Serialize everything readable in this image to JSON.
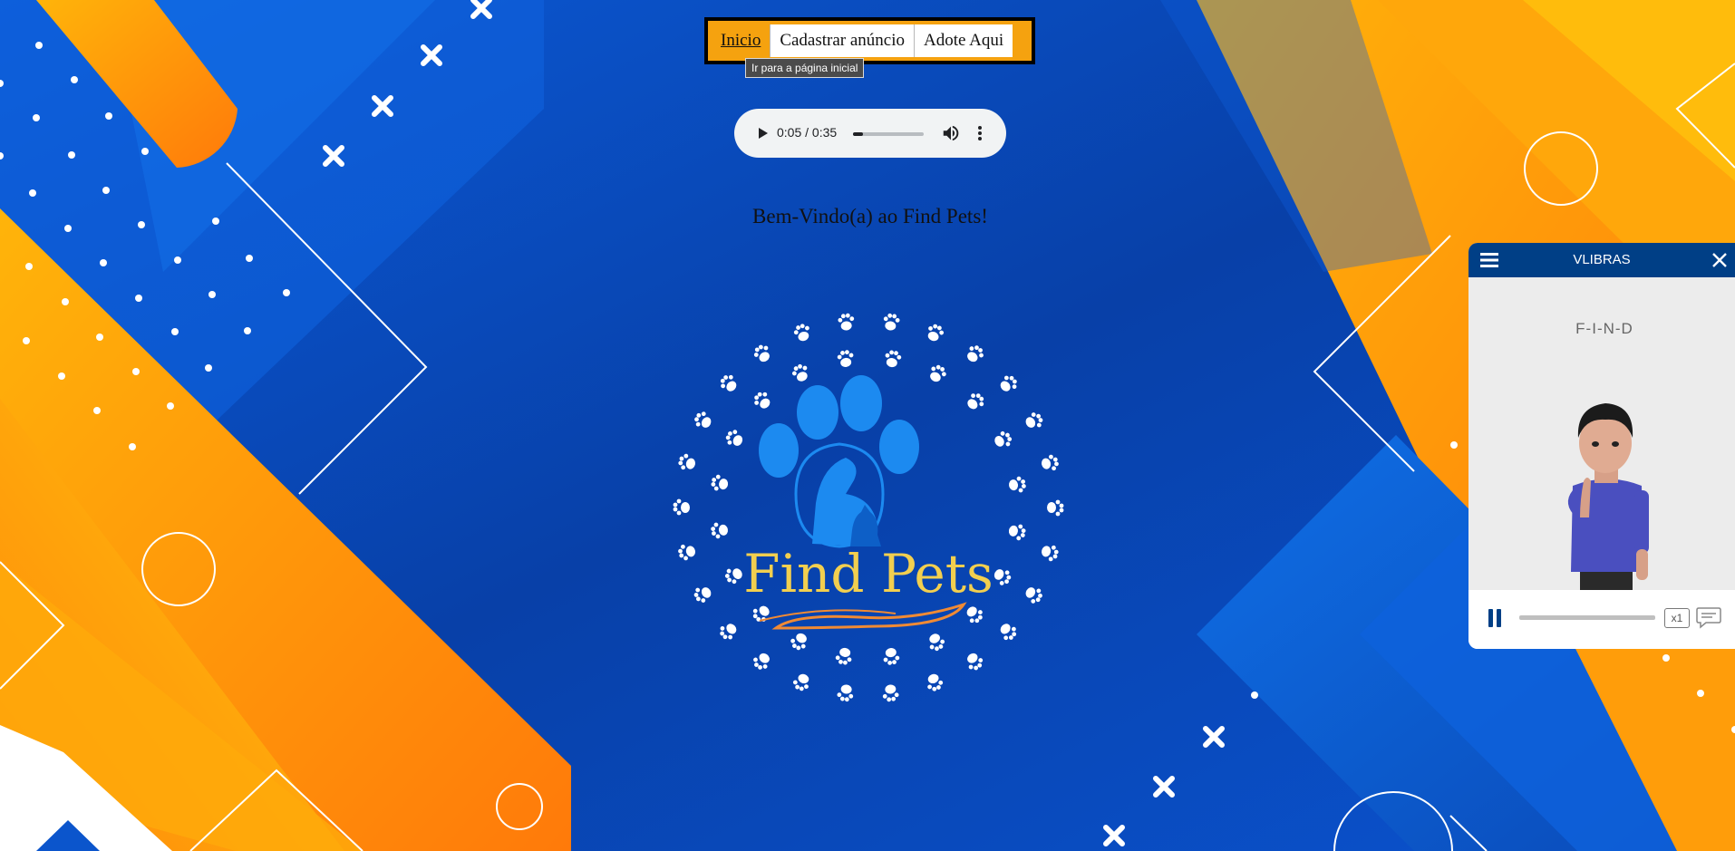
{
  "nav": {
    "items": [
      {
        "label": "Inicio",
        "active": true
      },
      {
        "label": "Cadastrar anúncio",
        "active": false
      },
      {
        "label": "Adote Aqui",
        "active": false
      }
    ],
    "tooltip": "Ir para a página inicial"
  },
  "audio": {
    "time": "0:05 / 0:35",
    "progress": 0.143,
    "icons": [
      "play-icon",
      "volume-icon",
      "more-options-icon"
    ]
  },
  "welcome_text": "Bem-Vindo(a) ao Find Pets!",
  "logo": {
    "text": "Find Pets",
    "colors": {
      "text": "#f2cf4f",
      "paw": "#1c8af0",
      "underline": "#f08a34"
    }
  },
  "vlibras": {
    "title": "VLIBRAS",
    "word": "F-I-N-D",
    "speed": "x1",
    "icons": [
      "menu-icon",
      "close-icon",
      "pause-icon",
      "subtitles-icon"
    ]
  },
  "colors": {
    "background_blue": "#0a4fc4",
    "orange": "#ff9a0c",
    "yellow": "#ffc000",
    "nav_border": "#000000",
    "nav_active": "#f5a20f",
    "vlibras_header": "#003f86"
  }
}
